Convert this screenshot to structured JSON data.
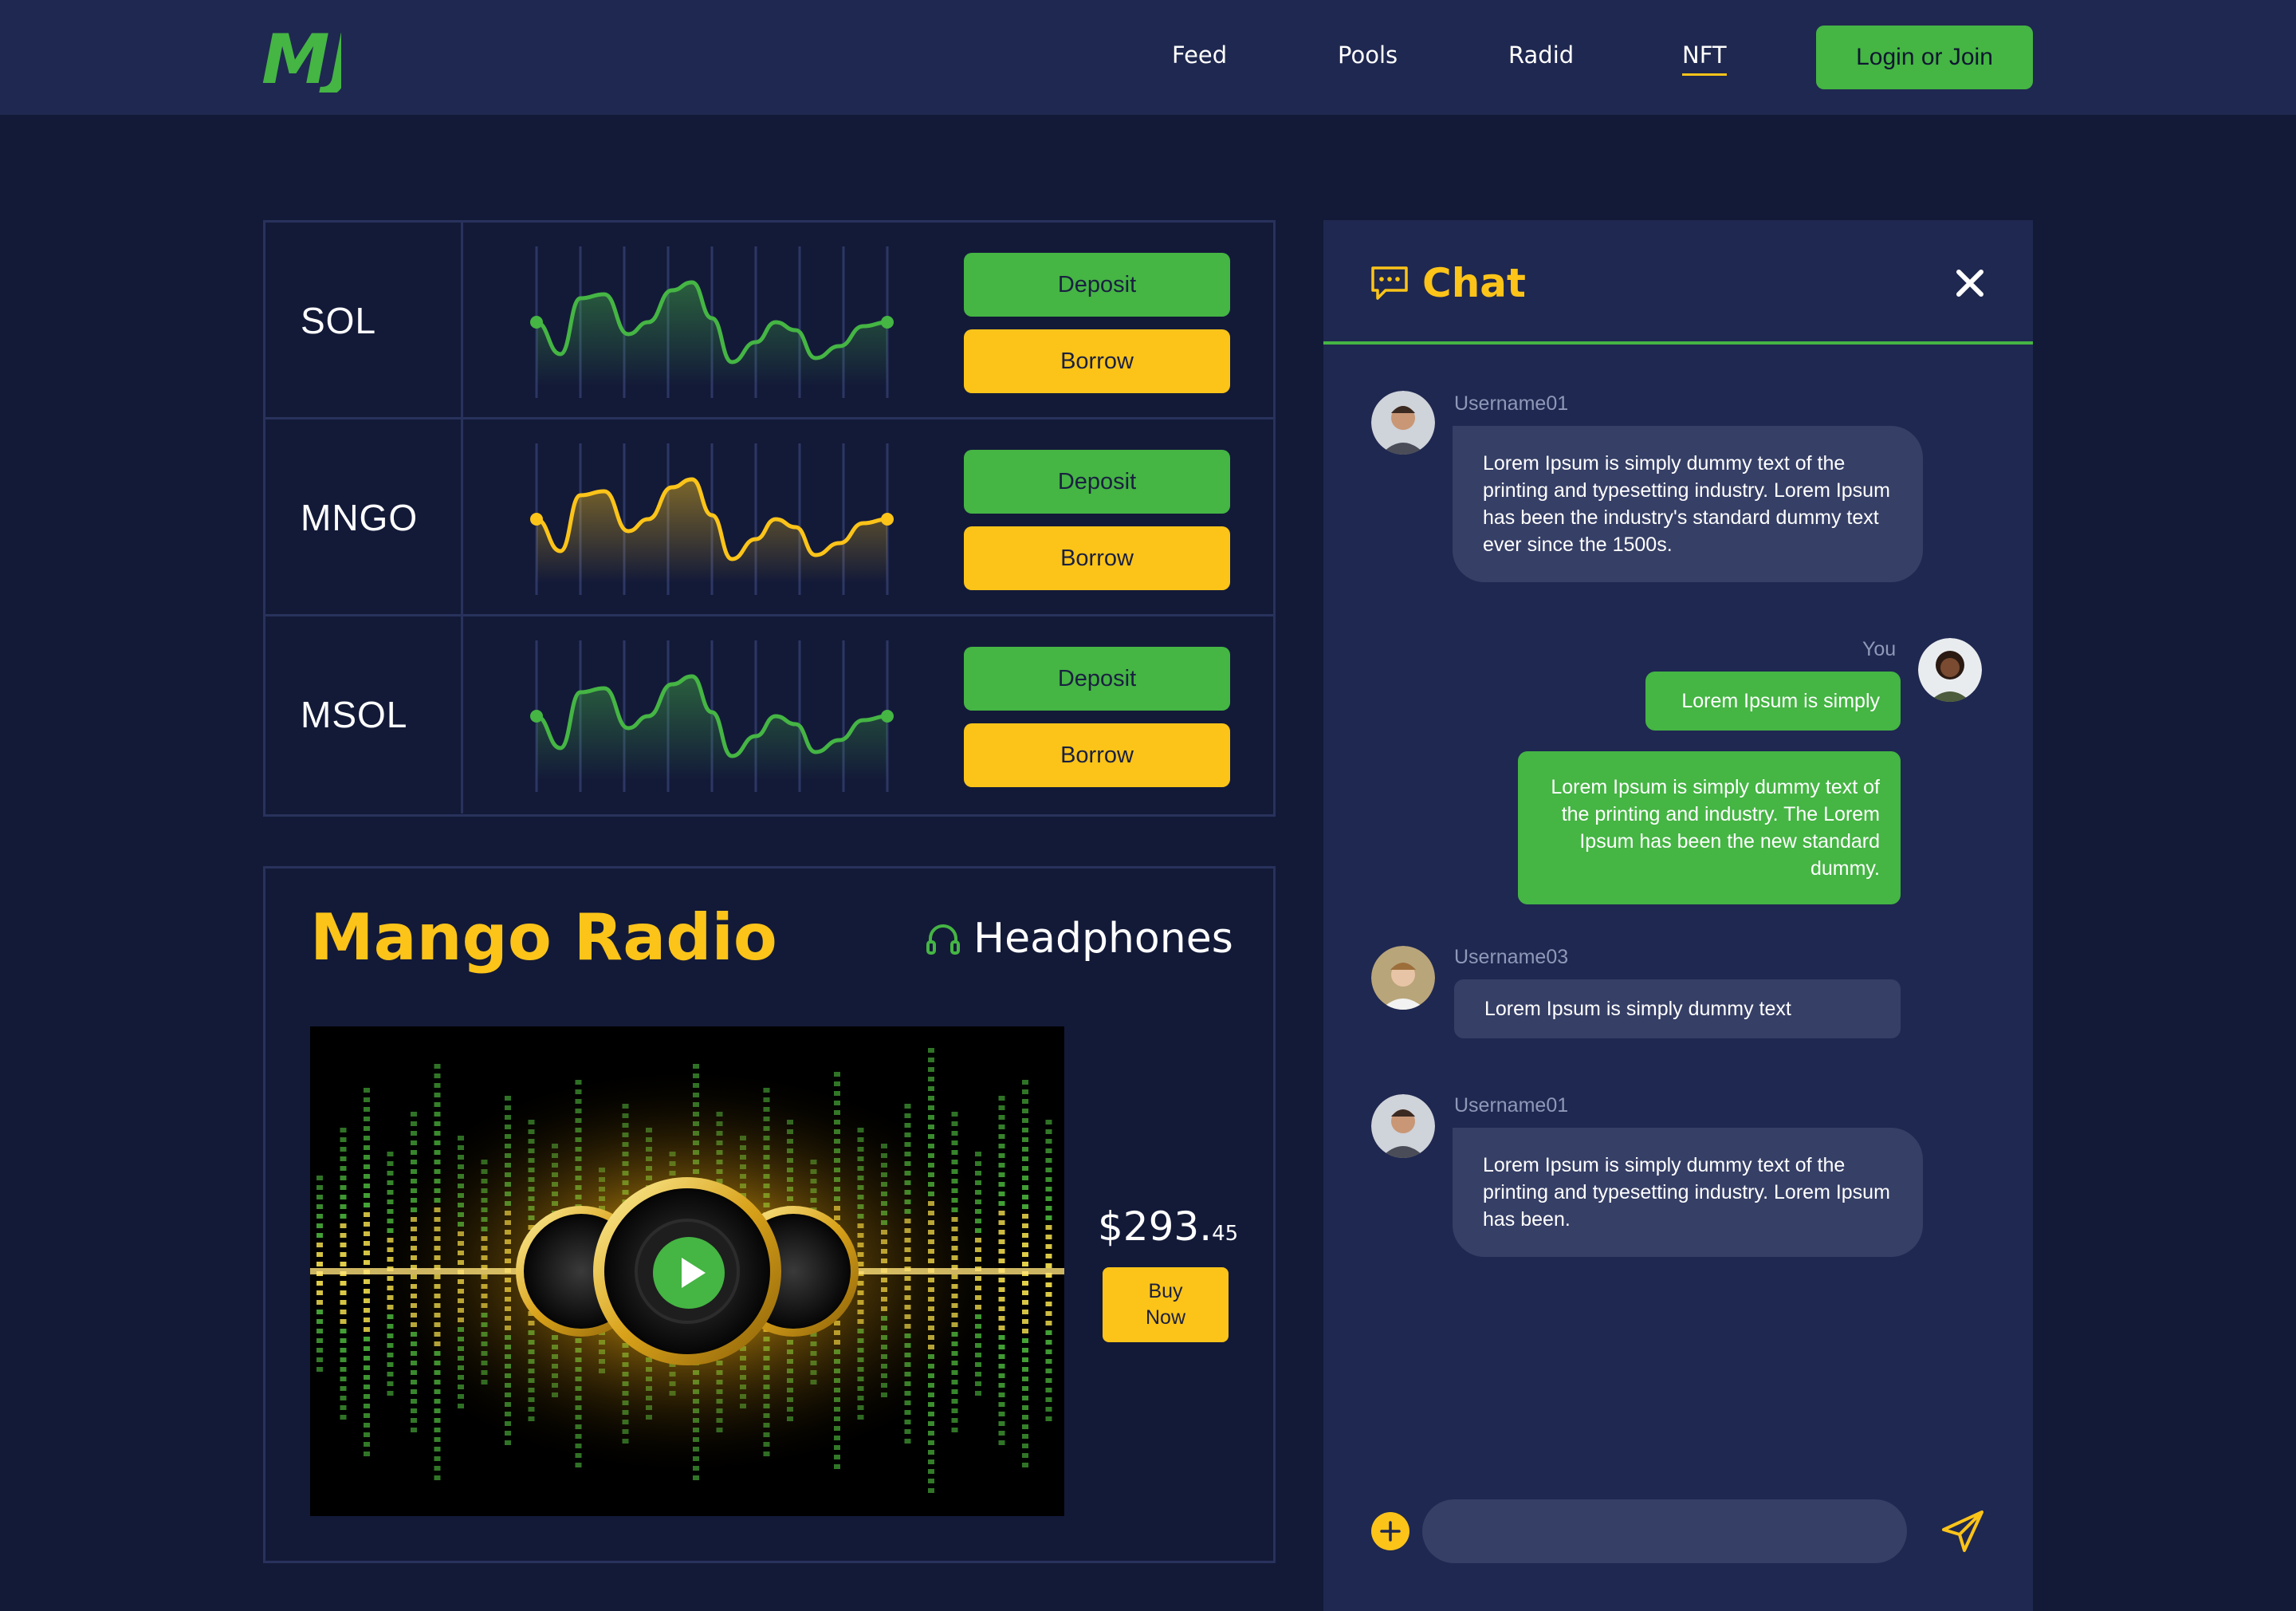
{
  "nav": {
    "brand": "MJ",
    "links": [
      {
        "label": "Feed"
      },
      {
        "label": "Pools"
      },
      {
        "label": "Radid"
      },
      {
        "label": "NFT"
      }
    ],
    "active_link": "NFT",
    "login_label": "Login or Join"
  },
  "pools": [
    {
      "symbol": "SOL",
      "wave_color": "#45b544",
      "deposit_label": "Deposit",
      "borrow_label": "Borrow"
    },
    {
      "symbol": "MNGO",
      "wave_color": "#fcc419",
      "deposit_label": "Deposit",
      "borrow_label": "Borrow"
    },
    {
      "symbol": "MSOL",
      "wave_color": "#45b544",
      "deposit_label": "Deposit",
      "borrow_label": "Borrow"
    }
  ],
  "radio": {
    "title": "Mango Radio",
    "device_label": "Headphones",
    "price_main": "$293.",
    "price_cents": "45",
    "buy_label": "Buy\nNow"
  },
  "chat": {
    "title": "Chat",
    "messages": [
      {
        "user": "Username01",
        "text": "Lorem Ipsum is simply dummy text of the printing and typesetting industry. Lorem Ipsum has been the industry's standard dummy text ever since the 1500s."
      },
      {
        "user": "You",
        "text": "Lorem Ipsum is simply"
      },
      {
        "user": "You",
        "text": "Lorem Ipsum is simply dummy text of the printing and industry. The Lorem Ipsum has been the new standard dummy."
      },
      {
        "user": "Username03",
        "text": "Lorem Ipsum is simply dummy text"
      },
      {
        "user": "Username01",
        "text": "Lorem Ipsum is simply dummy text of the printing and typesetting industry. Lorem Ipsum has been."
      }
    ],
    "input_placeholder": ""
  },
  "colors": {
    "background": "#131a38",
    "panel": "#1f2850",
    "bubble": "#363f66",
    "green": "#45b544",
    "yellow": "#fcc419",
    "border": "#28325c"
  },
  "icons": [
    "chat-bubble-icon",
    "close-icon",
    "headphones-icon",
    "play-icon",
    "plus-icon",
    "send-icon",
    "user-avatar"
  ]
}
